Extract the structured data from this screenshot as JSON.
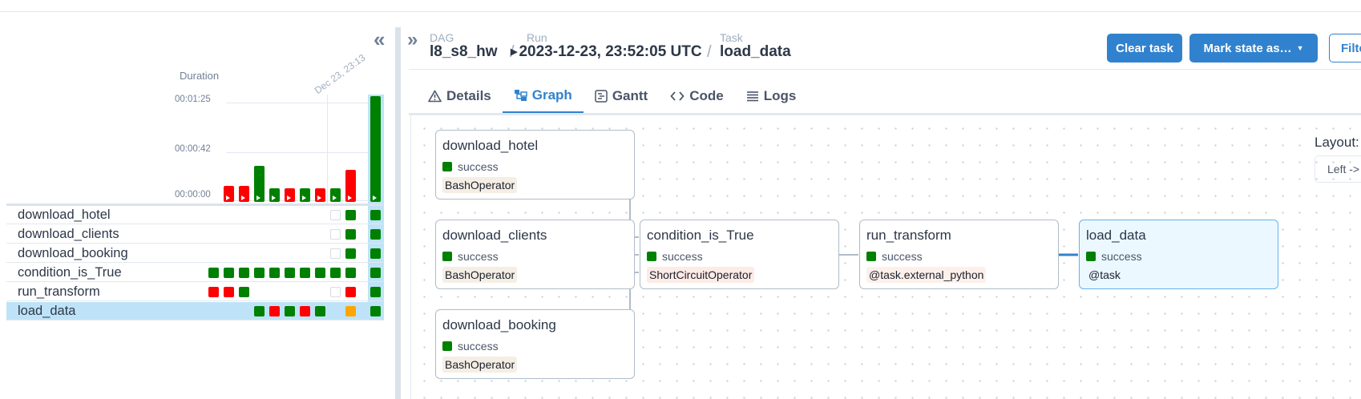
{
  "grid": {
    "duration_title": "Duration",
    "run_date": "Dec 23, 23:13",
    "ticks": [
      "00:01:25",
      "00:00:42",
      "00:00:00"
    ],
    "collapse_icon": "double-chevron-left-icon",
    "tasks": [
      {
        "name": "download_hotel",
        "cells": [
          null,
          null,
          null,
          null,
          null,
          null,
          null,
          null,
          "empty",
          "success",
          "success"
        ]
      },
      {
        "name": "download_clients",
        "cells": [
          null,
          null,
          null,
          null,
          null,
          null,
          null,
          null,
          "empty",
          "success",
          "success"
        ]
      },
      {
        "name": "download_booking",
        "cells": [
          null,
          null,
          null,
          null,
          null,
          null,
          null,
          null,
          "empty",
          "success",
          "success"
        ]
      },
      {
        "name": "condition_is_True",
        "cells": [
          "success",
          "success",
          "success",
          "success",
          "success",
          "success",
          "success",
          "success",
          "success",
          "success",
          "success"
        ]
      },
      {
        "name": "run_transform",
        "cells": [
          "failed",
          "failed",
          "success",
          null,
          null,
          null,
          null,
          null,
          "empty",
          "failed",
          "success"
        ]
      },
      {
        "name": "load_data",
        "cells": [
          null,
          null,
          null,
          "success",
          "failed",
          "success",
          "failed",
          "success",
          null,
          "upstream_failed",
          "success"
        ]
      }
    ],
    "runs": [
      {
        "state": "failed",
        "duration_frac": 0.15
      },
      {
        "state": "failed",
        "duration_frac": 0.15
      },
      {
        "state": "success",
        "duration_frac": 0.34
      },
      {
        "state": "success",
        "duration_frac": 0.13
      },
      {
        "state": "failed",
        "duration_frac": 0.13
      },
      {
        "state": "success",
        "duration_frac": 0.13
      },
      {
        "state": "failed",
        "duration_frac": 0.13
      },
      {
        "state": "success",
        "duration_frac": 0.13
      },
      {
        "state": "failed",
        "duration_frac": 0.3
      },
      {
        "state": "success",
        "duration_frac": 1.0
      }
    ]
  },
  "colors": {
    "success": "#008000",
    "failed": "#ff0000",
    "upstream_failed": "#ffa500",
    "accent": "#3182ce"
  },
  "header": {
    "dag_label": "DAG",
    "dag_value": "l8_s8_hw",
    "run_label": "Run",
    "run_value": "2023-12-23, 23:52:05 UTC",
    "task_label": "Task",
    "task_value": "load_data",
    "clear_task": "Clear task",
    "mark_state": "Mark state as…",
    "filter": "Filter"
  },
  "tabs": [
    {
      "label": "Details",
      "icon": "warning-triangle-icon"
    },
    {
      "label": "Graph",
      "icon": "graph-icon"
    },
    {
      "label": "Gantt",
      "icon": "gantt-icon"
    },
    {
      "label": "Code",
      "icon": "code-icon"
    },
    {
      "label": "Logs",
      "icon": "list-icon"
    }
  ],
  "graph": {
    "layout_label": "Layout:",
    "layout_value": "Left -> Right",
    "nodes": [
      {
        "name": "download_hotel",
        "state": "success",
        "operator": "BashOperator"
      },
      {
        "name": "download_clients",
        "state": "success",
        "operator": "BashOperator"
      },
      {
        "name": "download_booking",
        "state": "success",
        "operator": "BashOperator"
      },
      {
        "name": "condition_is_True",
        "state": "success",
        "operator": "ShortCircuitOperator"
      },
      {
        "name": "run_transform",
        "state": "success",
        "operator": "@task.external_python"
      },
      {
        "name": "load_data",
        "state": "success",
        "operator": "@task"
      }
    ]
  }
}
